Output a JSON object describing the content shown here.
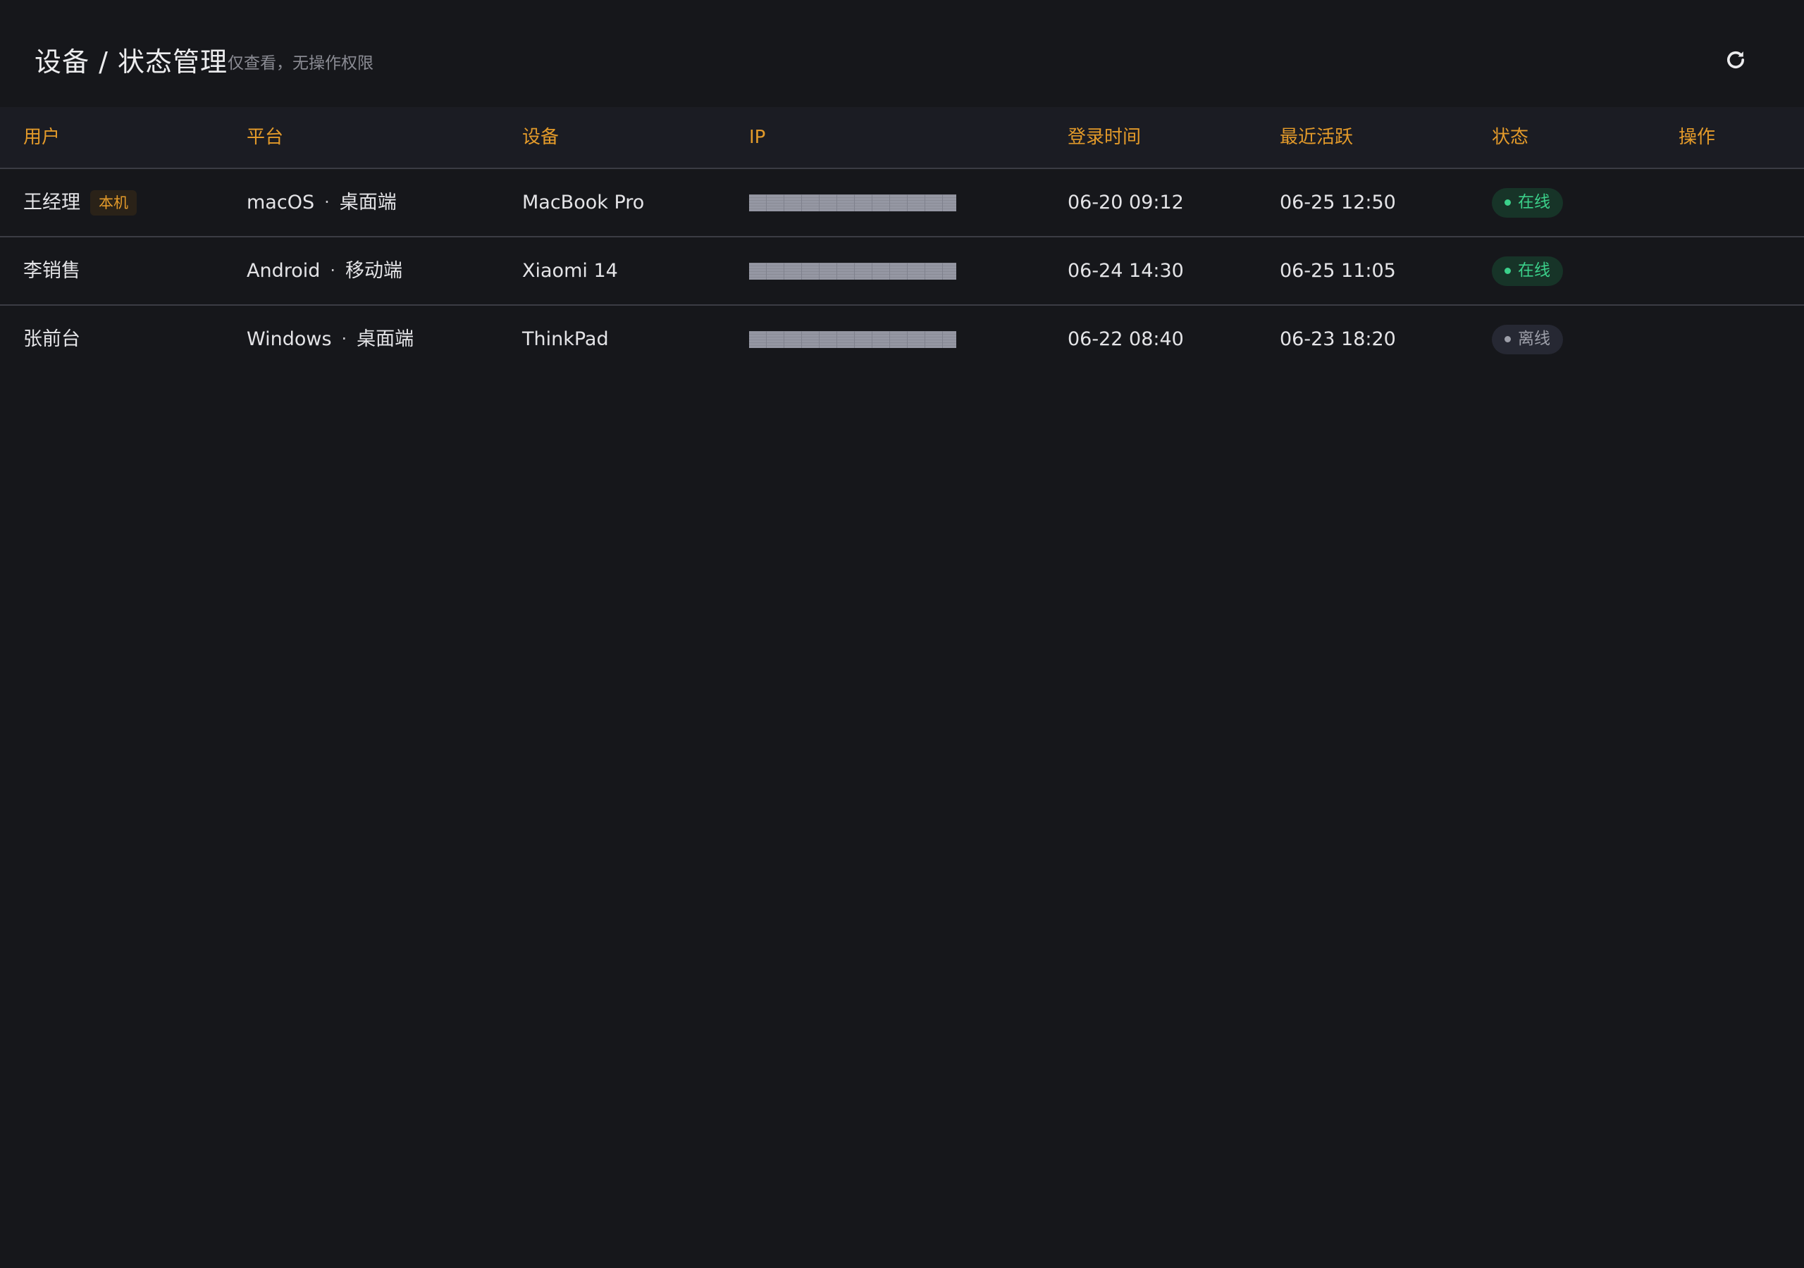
{
  "header": {
    "title": "设备 / 状态管理",
    "subtitle": "仅查看，无操作权限",
    "refresh_icon": "refresh-icon"
  },
  "table": {
    "columns": [
      "用户",
      "平台",
      "设备",
      "IP",
      "登录时间",
      "最近活跃",
      "状态",
      "操作"
    ],
    "rows": [
      {
        "user": "王经理",
        "badge": "本机",
        "os": "macOS",
        "separator": "·",
        "client": "桌面端",
        "device": "MacBook Pro",
        "ip": "",
        "login_time": "06-20 09:12",
        "last_active": "06-25 12:50",
        "status": "在线"
      },
      {
        "user": "李销售",
        "os": "Android",
        "separator": "·",
        "client": "移动端",
        "device": "Xiaomi 14",
        "ip": "",
        "login_time": "06-24 14:30",
        "last_active": "06-25 11:05",
        "status": "在线"
      },
      {
        "user": "张前台",
        "os": "Windows",
        "separator": "·",
        "client": "桌面端",
        "device": "ThinkPad",
        "ip": "",
        "login_time": "06-22 08:40",
        "last_active": "06-23 18:20",
        "status": "离线"
      }
    ]
  },
  "colors": {
    "background": "#16171b",
    "accent": "#e39a2a",
    "online": "#3bd08a",
    "offline": "#9d9fa9"
  }
}
